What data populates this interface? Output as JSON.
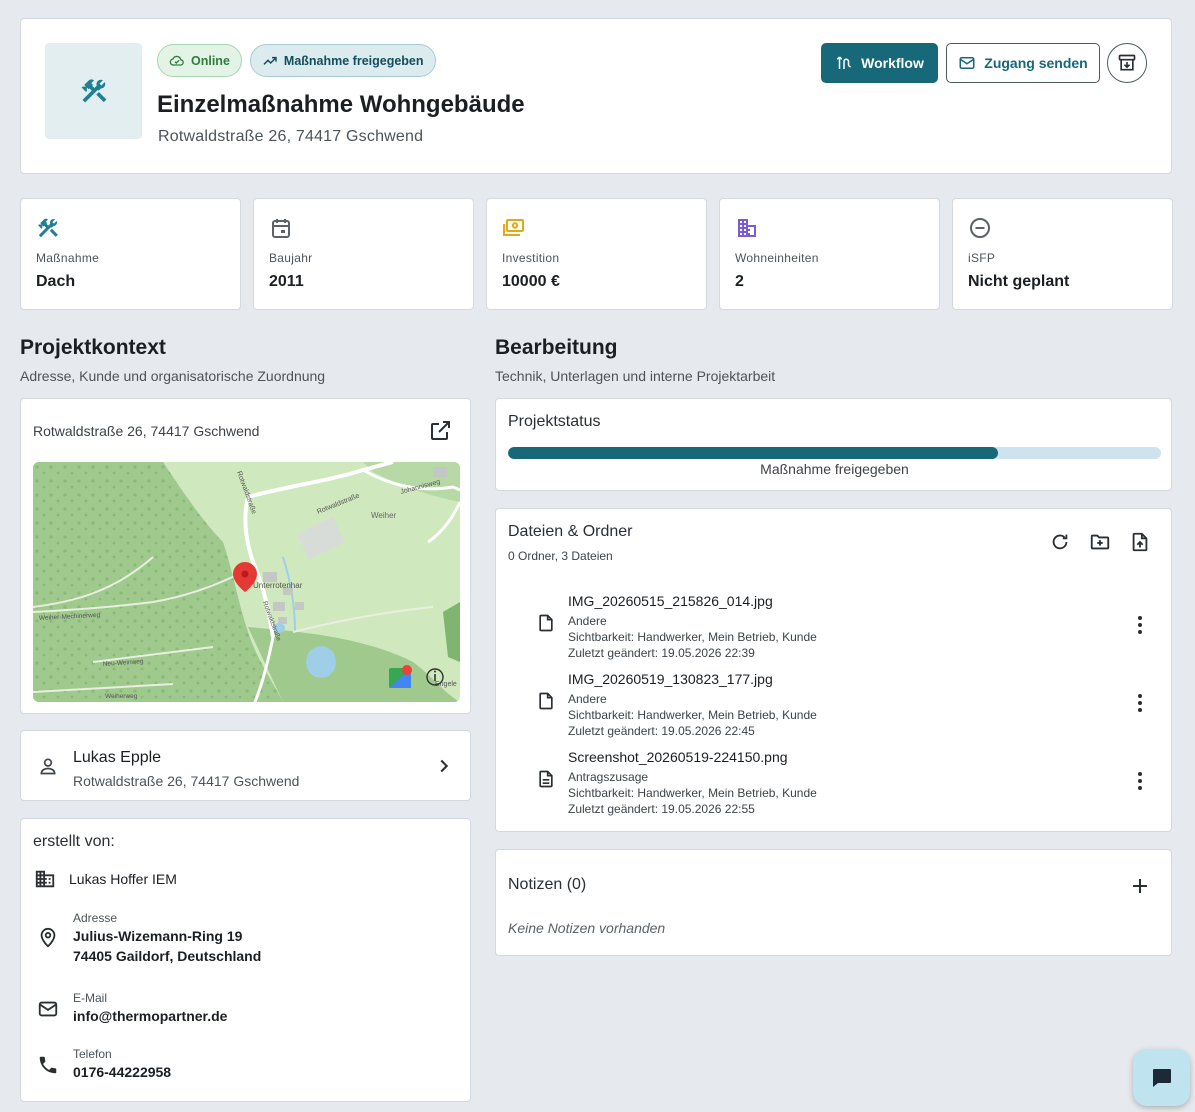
{
  "header": {
    "badges": {
      "online": "Online",
      "status": "Maßnahme freigegeben"
    },
    "title": "Einzelmaßnahme Wohngebäude",
    "address": "Rotwaldstraße 26, 74417 Gschwend",
    "buttons": {
      "workflow": "Workflow",
      "send_access": "Zugang senden"
    }
  },
  "stats": [
    {
      "icon": "tools-icon",
      "label": "Maßnahme",
      "value": "Dach",
      "color": "#1f7f93"
    },
    {
      "icon": "calendar-icon",
      "label": "Baujahr",
      "value": "2011",
      "color": "#5b6268"
    },
    {
      "icon": "cash-icon",
      "label": "Investition",
      "value": "10000 €",
      "color": "#e6a817"
    },
    {
      "icon": "building-icon",
      "label": "Wohneinheiten",
      "value": "2",
      "color": "#7b5bd6"
    },
    {
      "icon": "minus-circle-icon",
      "label": "iSFP",
      "value": "Nicht geplant",
      "color": "#5b6268"
    }
  ],
  "projektkontext": {
    "title": "Projektkontext",
    "subtitle": "Adresse, Kunde und organisatorische Zuordnung",
    "map": {
      "address": "Rotwaldstraße 26, 74417 Gschwend",
      "labels": [
        "Rotwaldstraße",
        "Rotwaldstraße",
        "Johannisweg",
        "Weiher",
        "Unterrotenhar",
        "Weiher-Mechinerweg",
        "Neu-Weinweg",
        "Weiherweg",
        "Rotwaldstraße",
        "Engele"
      ]
    },
    "contact": {
      "name": "Lukas Epple",
      "address": "Rotwaldstraße 26, 74417 Gschwend"
    },
    "created": {
      "heading": "erstellt von:",
      "company": "Lukas Hoffer IEM",
      "address_label": "Adresse",
      "address_line1": "Julius-Wizemann-Ring 19",
      "address_line2": "74405 Gaildorf, Deutschland",
      "email_label": "E-Mail",
      "email": "info@thermopartner.de",
      "phone_label": "Telefon",
      "phone": "0176-44222958"
    }
  },
  "bearbeitung": {
    "title": "Bearbeitung",
    "subtitle": "Technik, Unterlagen und interne Projektarbeit",
    "status": {
      "title": "Projektstatus",
      "label": "Maßnahme freigegeben",
      "progress": 0.75
    },
    "files": {
      "title": "Dateien & Ordner",
      "summary": "0 Ordner, 3 Dateien",
      "items": [
        {
          "name": "IMG_20260515_215826_014.jpg",
          "category": "Andere",
          "visibility": "Sichtbarkeit: Handwerker, Mein Betrieb, Kunde",
          "modified": "Zuletzt geändert: 19.05.2026 22:39",
          "icon": "file-icon"
        },
        {
          "name": "IMG_20260519_130823_177.jpg",
          "category": "Andere",
          "visibility": "Sichtbarkeit: Handwerker, Mein Betrieb, Kunde",
          "modified": "Zuletzt geändert: 19.05.2026 22:45",
          "icon": "file-icon"
        },
        {
          "name": "Screenshot_20260519-224150.png",
          "category": "Antragszusage",
          "visibility": "Sichtbarkeit: Handwerker, Mein Betrieb, Kunde",
          "modified": "Zuletzt geändert: 19.05.2026 22:55",
          "icon": "file-text-icon"
        }
      ]
    },
    "notes": {
      "title": "Notizen (0)",
      "empty": "Keine Notizen vorhanden"
    }
  },
  "colors": {
    "primary": "#176878",
    "background": "#e6eaee",
    "progress_track": "#cde3ee",
    "pin": "#e53935"
  }
}
